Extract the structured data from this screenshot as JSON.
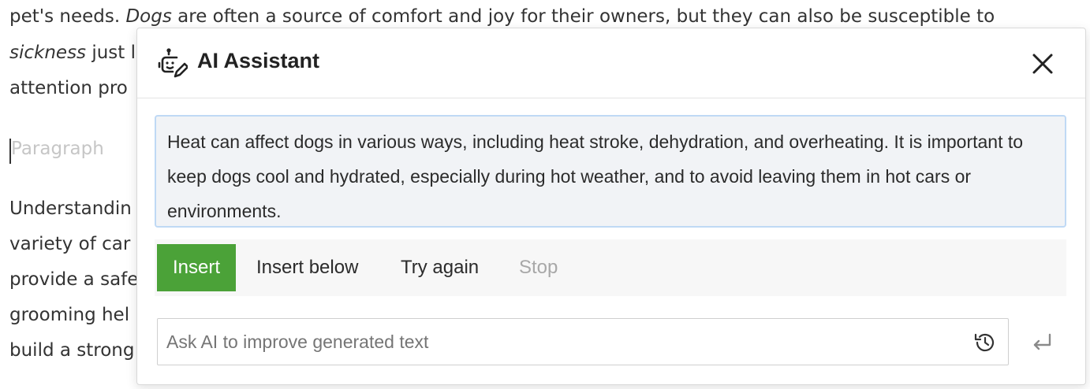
{
  "document": {
    "line1": {
      "before": "pet's needs. ",
      "em1": "Dogs",
      "after": " are often a source of comfort and joy for their owners, but they can also be susceptible to"
    },
    "line2": {
      "em1": "sickness",
      "after": " just li"
    },
    "line3": "attention pro",
    "placeholder": "Paragraph",
    "paragraph2": [
      "Understandin",
      "variety of car",
      "provide a safe",
      "grooming hel",
      "build a strong"
    ]
  },
  "dialog": {
    "title": "AI Assistant",
    "header_icon": "robot-pencil-icon",
    "close_icon": "close-icon",
    "response_text": "Heat can affect dogs in various ways, including heat stroke, dehydration, and overheating. It is important to keep dogs cool and hydrated, especially during hot weather, and to avoid leaving them in hot cars or environments.",
    "actions": {
      "insert": "Insert",
      "insert_below": "Insert below",
      "try_again": "Try again",
      "stop": "Stop"
    },
    "prompt": {
      "placeholder": "Ask AI to improve generated text",
      "value": "",
      "history_icon": "history-icon",
      "submit_icon": "enter-icon"
    }
  },
  "colors": {
    "accent_insert": "#4ba238",
    "response_bg": "#f1f3f6",
    "response_border": "#bfd9f5",
    "disabled_text": "#a8a8a8"
  }
}
